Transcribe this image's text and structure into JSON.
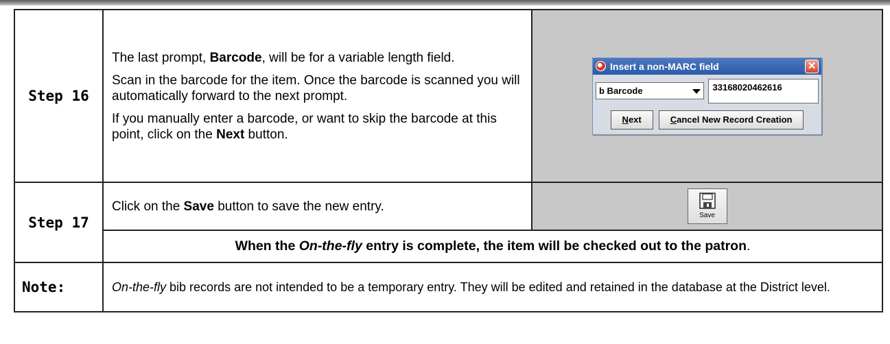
{
  "rows": {
    "step16": {
      "label": "Step 16",
      "p1_pre": "The last prompt, ",
      "p1_bold": "Barcode",
      "p1_post": ", will be for a variable length field.",
      "p2": "Scan in the barcode for the item.  Once the barcode is scanned you will automatically forward to the next prompt.",
      "p3_pre": "If you manually enter a barcode, or want to skip the barcode at this point, click on the ",
      "p3_bold": "Next",
      "p3_post": " button."
    },
    "step17": {
      "label": "Step 17",
      "text_pre": "Click on the ",
      "text_bold": "Save",
      "text_post": " button to save the new entry.",
      "complete_pre": "When the ",
      "complete_italic": "On-the-fly",
      "complete_mid": " entry is complete, the item will be checked out to the patron",
      "complete_end": "."
    },
    "note": {
      "label": "Note:",
      "italic": "On-the-fly",
      "text": " bib records are not intended to be a temporary entry.  They will be edited and retained in the database at the District level."
    }
  },
  "dialog": {
    "title": "Insert a non-MARC field",
    "close_glyph": "✕",
    "combo_value": "b Barcode",
    "field_value": "33168020462616",
    "next_mnemonic": "N",
    "next_rest": "ext",
    "cancel_mnemonic": "C",
    "cancel_rest": "ancel New Record Creation"
  },
  "save_button": {
    "label": "Save",
    "icon": "floppy-disk-icon"
  },
  "colors": {
    "gray_cell": "#c8c8c8",
    "title_bar": "#2c5aa8",
    "close_button": "#d4442c"
  }
}
